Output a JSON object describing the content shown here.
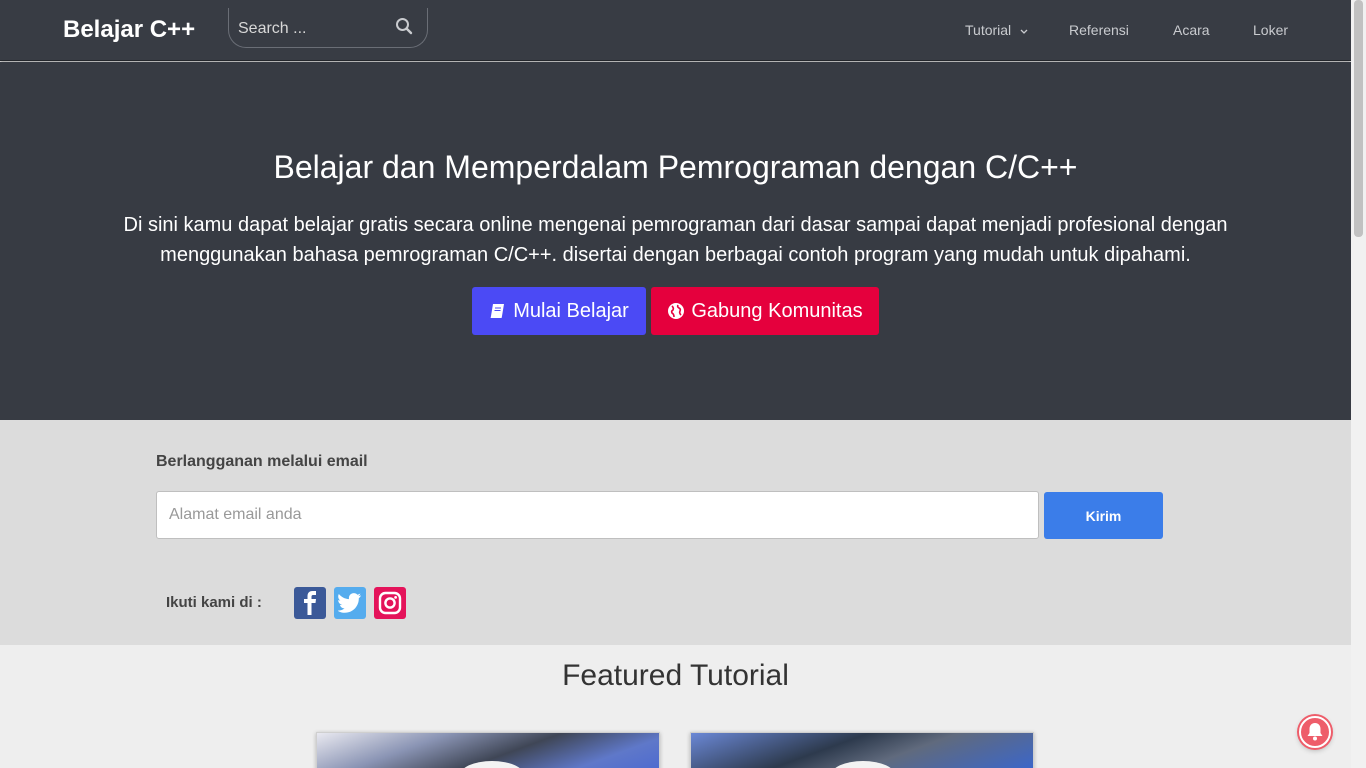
{
  "navbar": {
    "brand": "Belajar C++",
    "search_placeholder": "Search ...",
    "items": [
      {
        "label": "Tutorial"
      },
      {
        "label": "Referensi"
      },
      {
        "label": "Acara"
      },
      {
        "label": "Loker"
      }
    ]
  },
  "hero": {
    "title": "Belajar dan Memperdalam Pemrograman dengan C/C++",
    "description": "Di sini kamu dapat belajar gratis secara online mengenai pemrograman dari dasar sampai dapat menjadi profesional dengan menggunakan bahasa pemrograman C/C++. disertai dengan berbagai contoh program yang mudah untuk dipahami.",
    "primary_button": "Mulai Belajar",
    "secondary_button": "Gabung Komunitas"
  },
  "subscribe": {
    "title": "Berlangganan melalui email",
    "email_placeholder": "Alamat email anda",
    "submit_label": "Kirim",
    "follow_label": "Ikuti kami di :",
    "social": [
      "facebook-icon",
      "twitter-icon",
      "instagram-icon"
    ]
  },
  "featured": {
    "title": "Featured Tutorial"
  },
  "colors": {
    "navbar": "#383c44",
    "hero": "#373b43",
    "primary_button": "#4b4af5",
    "secondary_button": "#e5003d",
    "submit_button": "#3b7de9",
    "notification_bell": "#ee5d6a"
  }
}
